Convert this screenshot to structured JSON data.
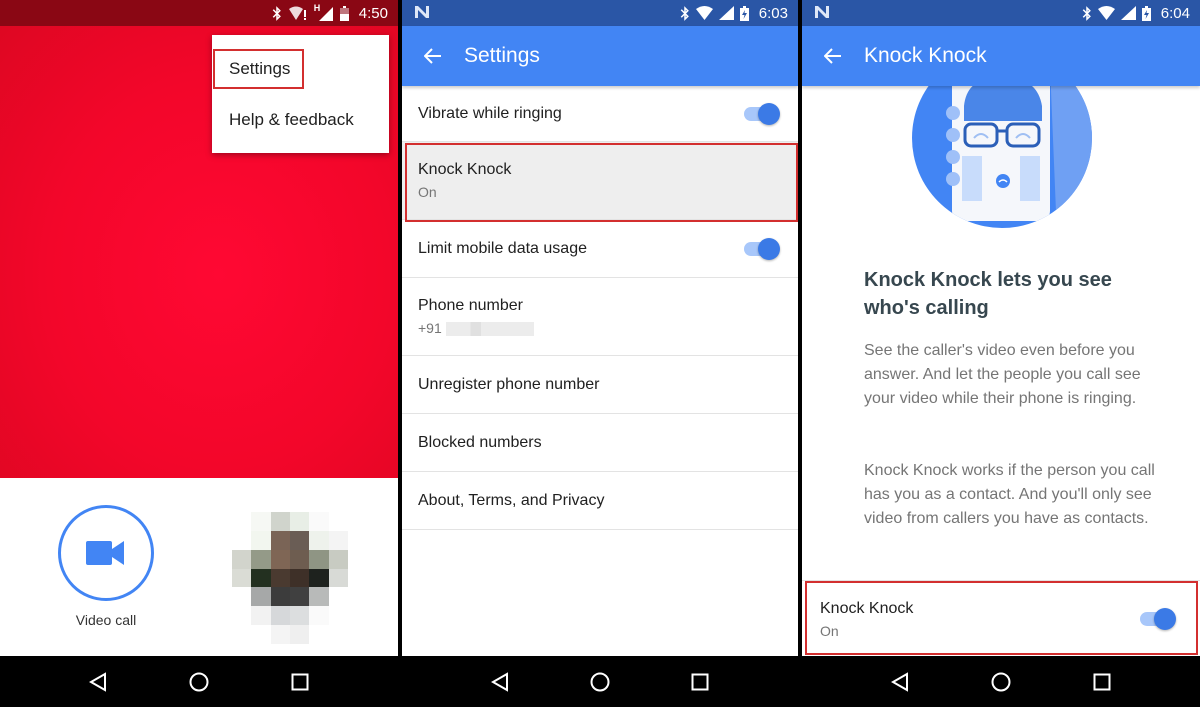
{
  "colors": {
    "accent_blue": "#4285f4",
    "status_blue": "#2a56a6",
    "red_bg": "#f3062a",
    "status_red": "#8a0714",
    "highlight_red": "#d32f2f"
  },
  "screen1": {
    "status_bar": {
      "icons": [
        "bluetooth-icon",
        "wifi-alert-icon",
        "hspa-signal-icon",
        "battery-icon"
      ],
      "network_label": "H",
      "time": "4:50"
    },
    "overflow_menu": {
      "items": [
        {
          "label": "Settings",
          "highlighted": true
        },
        {
          "label": "Help & feedback",
          "highlighted": false
        }
      ]
    },
    "video_call": {
      "label": "Video call",
      "icon": "video-camera-icon"
    },
    "contact_avatar": {
      "state": "pixelated"
    },
    "nav": [
      "back-icon",
      "home-icon",
      "recents-icon"
    ]
  },
  "screen2": {
    "status_bar": {
      "notification_icon": "n-icon",
      "icons": [
        "bluetooth-icon",
        "wifi-icon",
        "signal-icon",
        "battery-charging-icon"
      ],
      "time": "6:03"
    },
    "app_bar": {
      "title": "Settings",
      "back_icon": "arrow-back-icon"
    },
    "settings": [
      {
        "label": "Vibrate while ringing",
        "toggle": true
      },
      {
        "label": "Knock Knock",
        "sublabel": "On",
        "highlighted": true
      },
      {
        "label": "Limit mobile data usage",
        "toggle": true
      },
      {
        "label": "Phone number",
        "sublabel": "+91",
        "redacted": true
      },
      {
        "label": "Unregister phone number"
      },
      {
        "label": "Blocked numbers"
      },
      {
        "label": "About, Terms, and Privacy"
      }
    ],
    "nav": [
      "back-icon",
      "home-icon",
      "recents-icon"
    ]
  },
  "screen3": {
    "status_bar": {
      "notification_icon": "n-icon",
      "icons": [
        "bluetooth-icon",
        "wifi-icon",
        "signal-icon",
        "battery-charging-icon"
      ],
      "time": "6:04"
    },
    "app_bar": {
      "title": "Knock Knock",
      "back_icon": "arrow-back-icon"
    },
    "illustration": "person-on-phone-illustration",
    "heading": "Knock Knock lets you see who's calling",
    "paragraph1": "See the caller's video even before you answer. And let the people you call see your video while their phone is ringing.",
    "paragraph2": "Knock Knock works if the person you call has you as a contact. And you'll only see video from callers you have as contacts.",
    "toggle_row": {
      "label": "Knock Knock",
      "sublabel": "On",
      "toggle": true,
      "highlighted": true
    },
    "nav": [
      "back-icon",
      "home-icon",
      "recents-icon"
    ]
  }
}
